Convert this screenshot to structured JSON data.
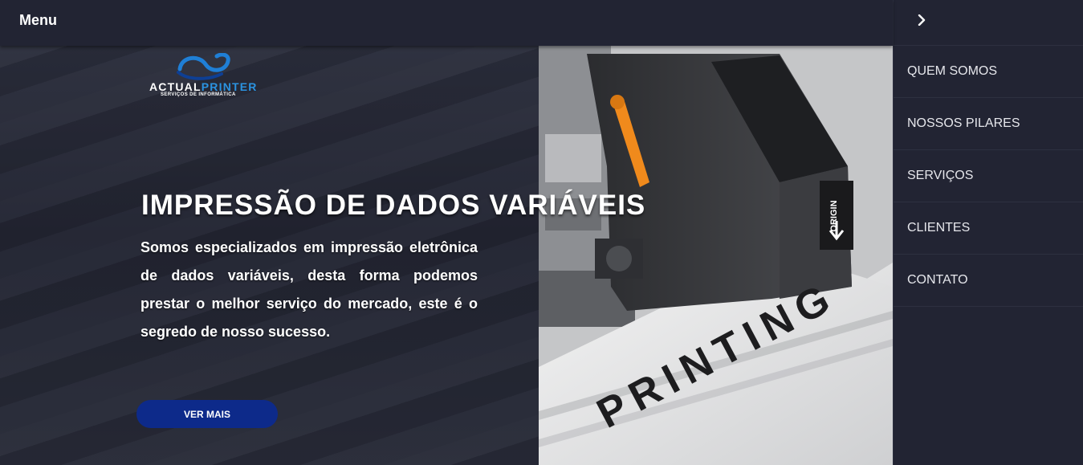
{
  "topbar": {
    "menu_label": "Menu"
  },
  "logo": {
    "word_main": "ACTUAL",
    "word_accent": "PRINTER",
    "subtitle": "SERVIÇOS DE INFORMÁTICA"
  },
  "hero": {
    "title": "IMPRESSÃO DE DADOS VARIÁVEIS",
    "description": "Somos especializados em impressão eletrônica de dados variáveis, desta forma podemos prestar o melhor serviço do mercado, este é o segredo de nosso sucesso.",
    "cta_label": "VER MAIS",
    "photo_text": {
      "print_word": "PRINTING",
      "origin_label": "ORIGIN"
    }
  },
  "sidebar": {
    "close_icon": "chevron-right-icon",
    "items": [
      {
        "label": "QUEM SOMOS"
      },
      {
        "label": "NOSSOS PILARES"
      },
      {
        "label": "SERVIÇOS"
      },
      {
        "label": "CLIENTES"
      },
      {
        "label": "CONTATO"
      }
    ]
  },
  "colors": {
    "panel_bg": "#222433",
    "cta_bg": "#0d2a8a",
    "logo_accent": "#2b93e0",
    "lever_orange": "#f08a1c"
  }
}
